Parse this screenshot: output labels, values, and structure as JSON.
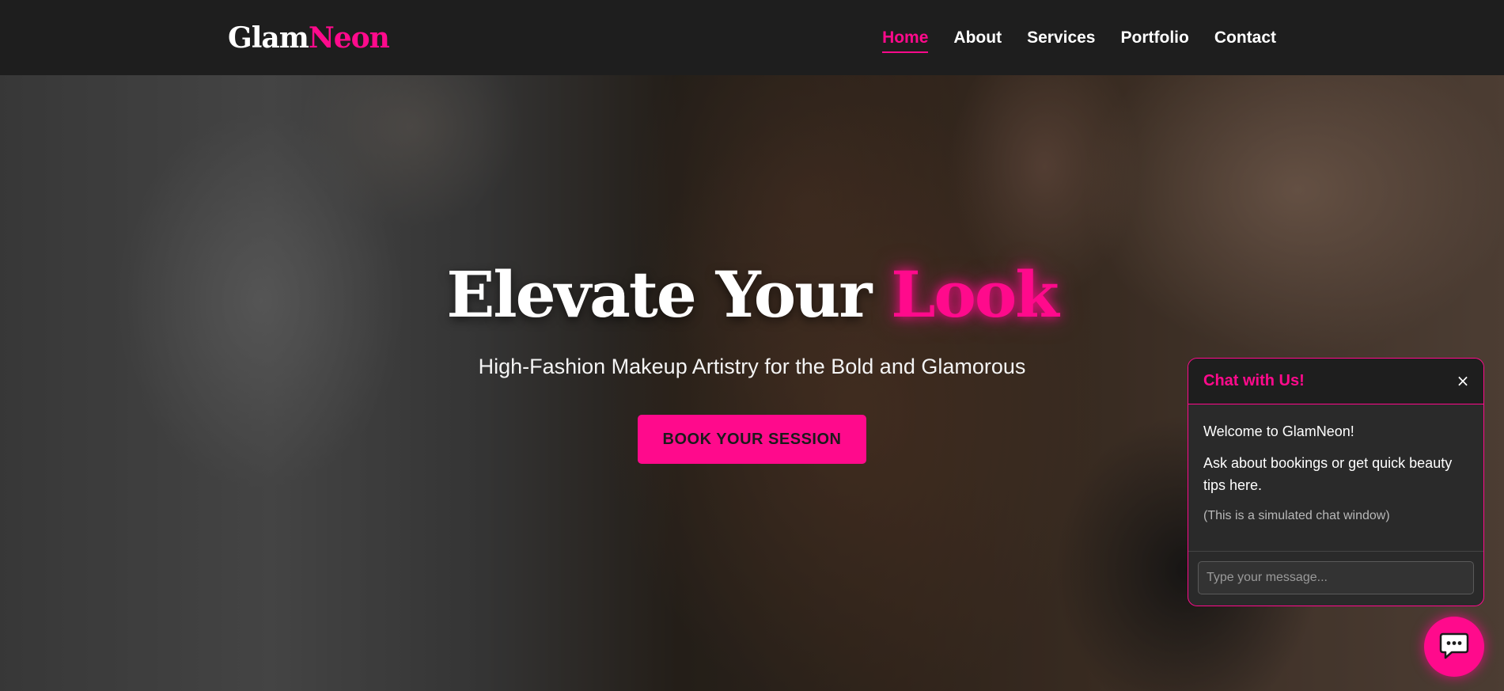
{
  "brand": {
    "logo_part1": "Glam",
    "logo_part2": "Neon",
    "accent_color": "#ff0a8c"
  },
  "nav": {
    "items": [
      {
        "label": "Home",
        "active": true
      },
      {
        "label": "About",
        "active": false
      },
      {
        "label": "Services",
        "active": false
      },
      {
        "label": "Portfolio",
        "active": false
      },
      {
        "label": "Contact",
        "active": false
      }
    ]
  },
  "hero": {
    "title_part1": "Elevate Your ",
    "title_highlight": "Look",
    "subtitle": "High-Fashion Makeup Artistry for the Bold and Glamorous",
    "cta_label": "BOOK YOUR SESSION"
  },
  "chat": {
    "title": "Chat with Us!",
    "close_symbol": "×",
    "messages": [
      "Welcome to GlamNeon!",
      "Ask about bookings or get quick beauty tips here."
    ],
    "note": "(This is a simulated chat window)",
    "input_placeholder": "Type your message..."
  },
  "chat_toggle": {
    "icon": "chat-bubble-icon"
  }
}
